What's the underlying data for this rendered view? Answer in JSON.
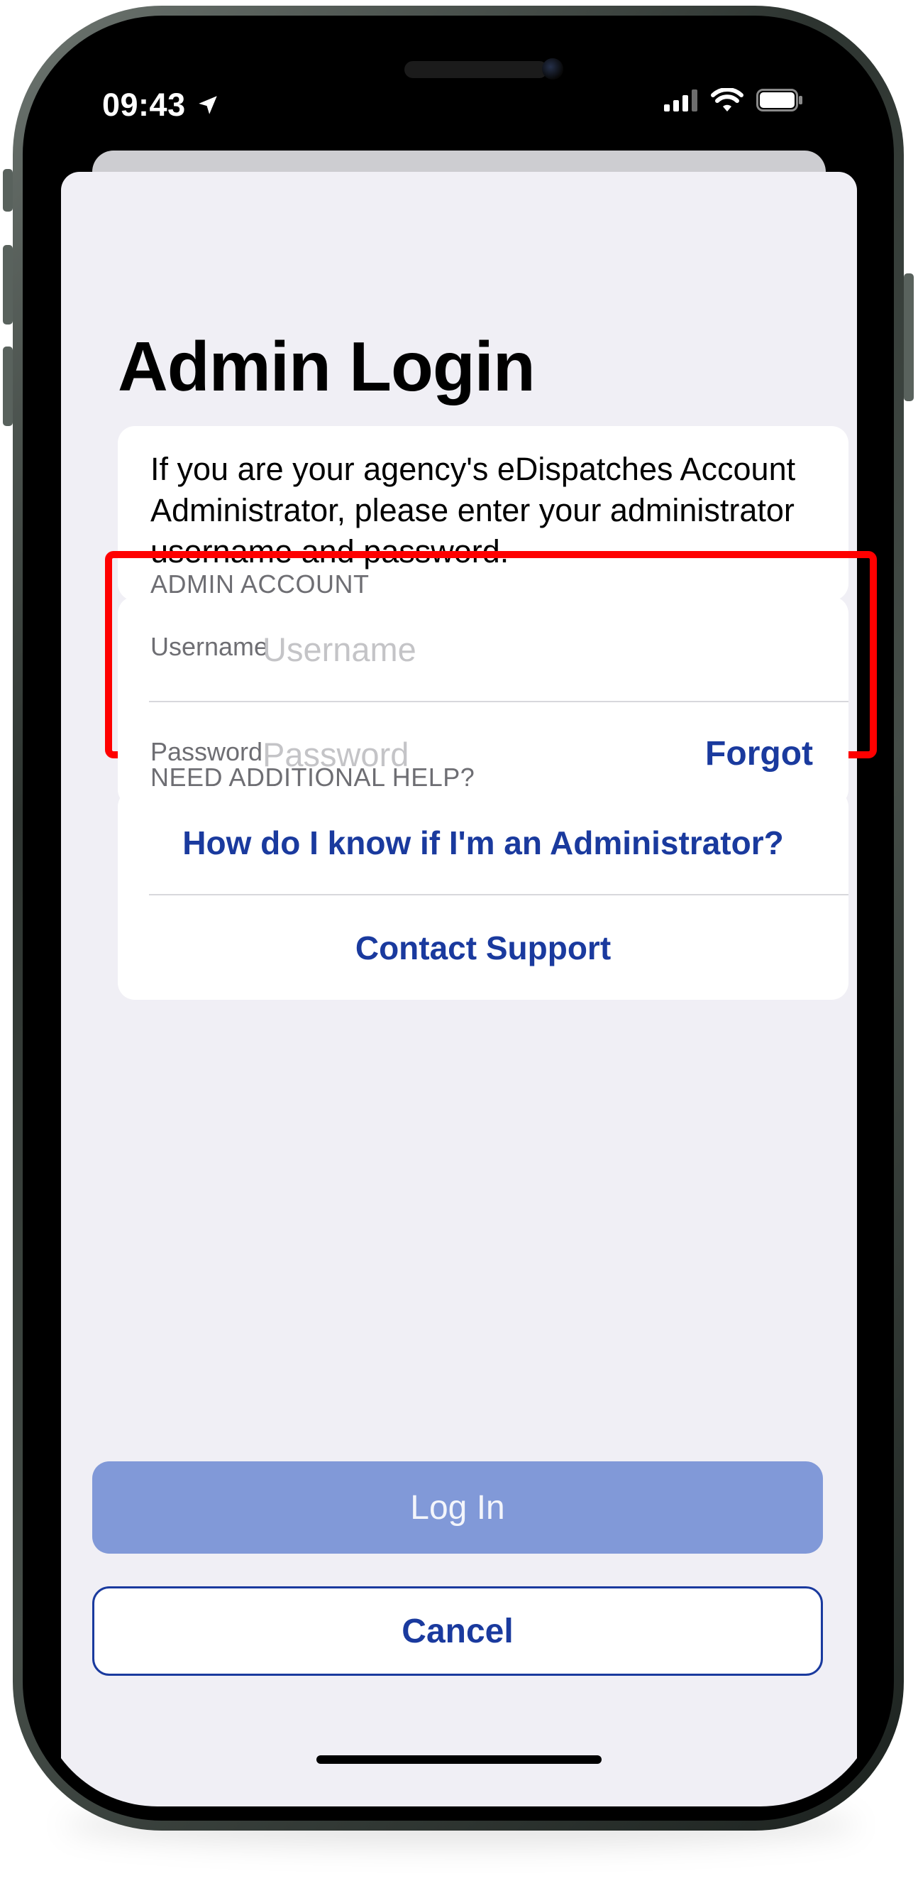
{
  "status_bar": {
    "time": "09:43",
    "location_icon": "location-arrow-icon",
    "signal_icon": "cellular-signal-icon",
    "wifi_icon": "wifi-icon",
    "battery_icon": "battery-icon"
  },
  "page": {
    "title": "Admin Login",
    "info_text": "If you are your agency's eDispatches Account Administrator, please enter your administrator username and password."
  },
  "admin_account": {
    "header": "ADMIN ACCOUNT",
    "username_label": "Username",
    "username_placeholder": "Username",
    "username_value": "",
    "password_label": "Password",
    "password_placeholder": "Password",
    "password_value": "",
    "forgot_label": "Forgot"
  },
  "help": {
    "header": "NEED ADDITIONAL HELP?",
    "links": [
      "How do I know if I'm an Administrator?",
      "Contact Support"
    ]
  },
  "actions": {
    "login_label": "Log In",
    "cancel_label": "Cancel"
  },
  "colors": {
    "accent": "#1a3a9e",
    "login_disabled": "#8199d8",
    "sheet_background": "#f0eff5",
    "highlight": "#ff0000"
  }
}
